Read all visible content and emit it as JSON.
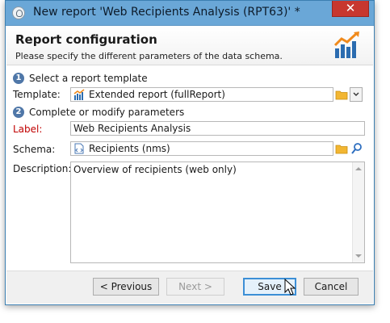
{
  "window": {
    "title": "New report 'Web Recipients Analysis (RPT63)' *",
    "close_glyph": "✕"
  },
  "header": {
    "title": "Report configuration",
    "subtitle": "Please specify the different parameters of the data schema.",
    "icon": "report-chart-icon"
  },
  "steps": [
    {
      "number": "1",
      "label": "Select a report template"
    },
    {
      "number": "2",
      "label": "Complete or modify parameters"
    }
  ],
  "form": {
    "template": {
      "label": "Template:",
      "value": "Extended report (fullReport)",
      "icon": "chart-icon"
    },
    "label_field": {
      "label": "Label:",
      "value": "Web Recipients Analysis"
    },
    "schema": {
      "label": "Schema:",
      "value": "Recipients (nms)",
      "icon": "schema-icon"
    },
    "description": {
      "label": "Description:",
      "value": "Overview of recipients (web only)"
    }
  },
  "buttons": {
    "previous": "< Previous",
    "next": "Next >",
    "save": "Save",
    "cancel": "Cancel"
  },
  "colors": {
    "titlebar": "#6aa7d7",
    "close": "#c7372f",
    "required_label": "#c00000",
    "step_badge": "#4f77a8",
    "default_button_border": "#3c8fd6"
  }
}
